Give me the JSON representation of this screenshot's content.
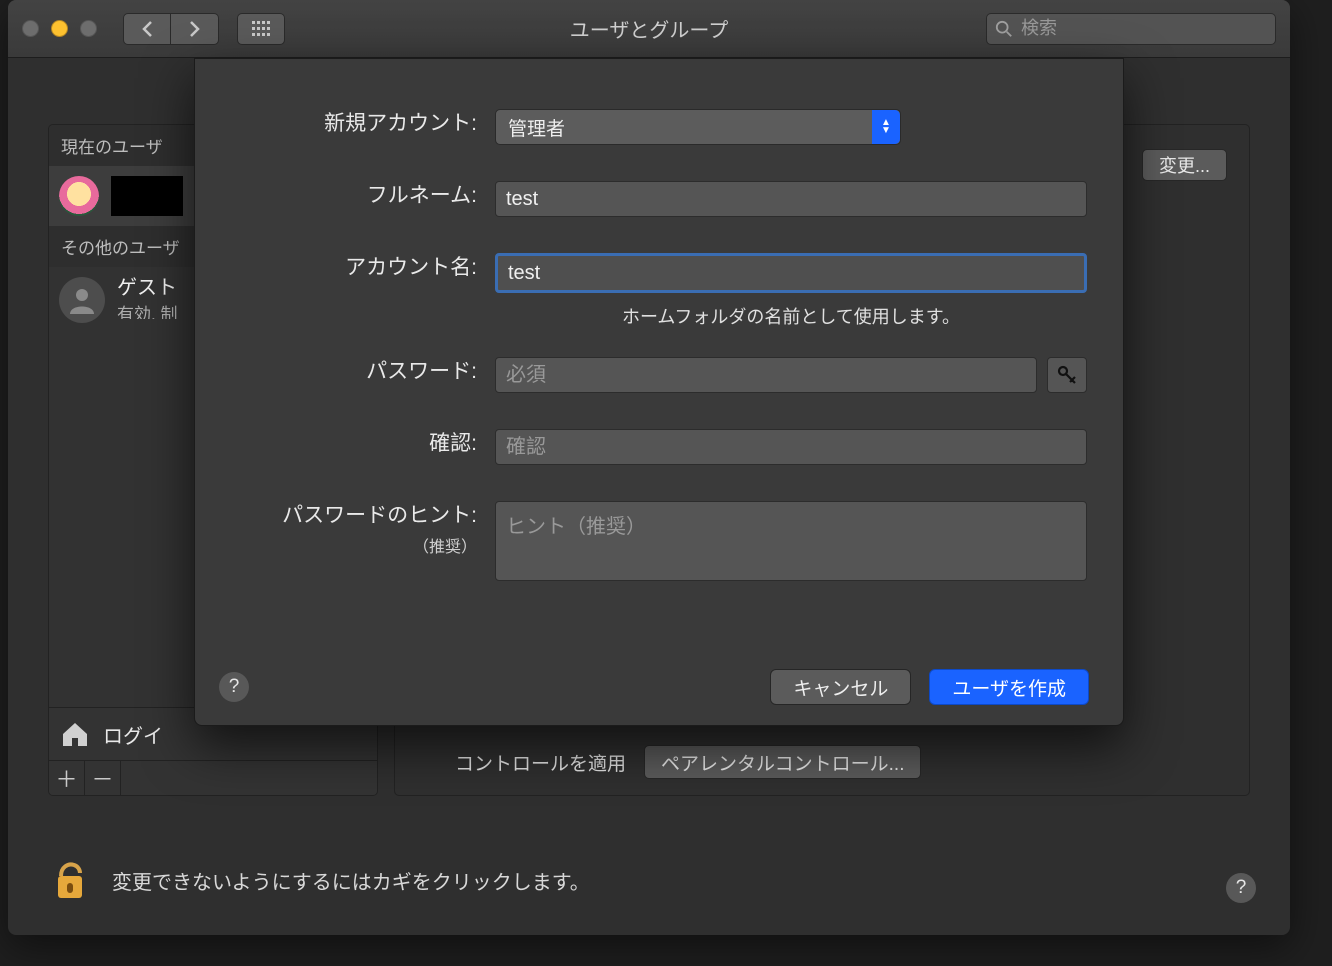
{
  "window": {
    "title": "ユーザとグループ",
    "search_placeholder": "検索"
  },
  "sidebar": {
    "current_header": "現在のユーザ",
    "other_header": "その他のユーザ",
    "guest": {
      "title": "ゲスト",
      "subtitle": "有効, 制"
    },
    "login_options": "ログイ"
  },
  "right_panel": {
    "change_label": "変更...",
    "parental_apply": "コントロールを適用",
    "parental_button": "ペアレンタルコントロール..."
  },
  "footer": {
    "lock_text": "変更できないようにするにはカギをクリックします。"
  },
  "sheet": {
    "new_account_label": "新規アカウント:",
    "new_account_value": "管理者",
    "fullname_label": "フルネーム:",
    "fullname_value": "test",
    "account_name_label": "アカウント名:",
    "account_name_value": "test",
    "account_name_hint": "ホームフォルダの名前として使用します。",
    "password_label": "パスワード:",
    "password_placeholder": "必須",
    "verify_label": "確認:",
    "verify_placeholder": "確認",
    "hint_label": "パスワードのヒント:",
    "hint_sub": "（推奨）",
    "hint_placeholder": "ヒント（推奨）",
    "cancel": "キャンセル",
    "create": "ユーザを作成"
  }
}
